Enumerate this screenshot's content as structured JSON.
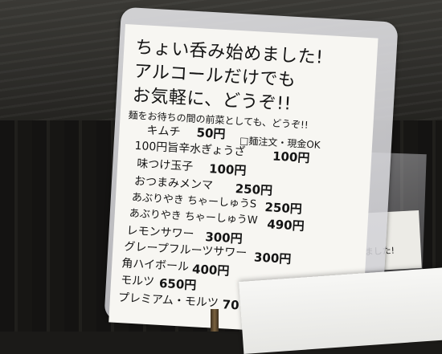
{
  "sign": {
    "headline_1": "ちょい呑み始めました!",
    "headline_2": "アルコールだけでも",
    "headline_3": "お気軽に、どうぞ!!",
    "subtitle": "麺をお待ちの間の前菜としても、どうぞ!!",
    "kimchi": "キムチ",
    "kimchi_price": "50円",
    "gyoza": "100円旨辛水ぎょうざ",
    "gyoza_price": "100円",
    "note": "□麺注文・現金OK",
    "egg": "味つけ玉子",
    "egg_price": "100円",
    "menma": "おつまみメンマ",
    "menma_price": "250円",
    "chashu_s": "あぶりやき ちゃーしゅうS",
    "chashu_s_price": "250円",
    "chashu_w": "あぶりやき ちゃーしゅうW",
    "chashu_w_price": "490円",
    "lemon_sour": "レモンサワー",
    "lemon_sour_price": "300円",
    "grapefruit_sour": "グレープフルーツサワー",
    "grapefruit_sour_price": "300円",
    "highball": "角ハイボール",
    "highball_price": "400円",
    "malts": "モルツ",
    "malts_price": "650円",
    "premium_malts": "プレミアム・モルツ",
    "premium_malts_price": "70"
  },
  "background_note": {
    "line_1": "した",
    "line_2": "なりました!"
  }
}
